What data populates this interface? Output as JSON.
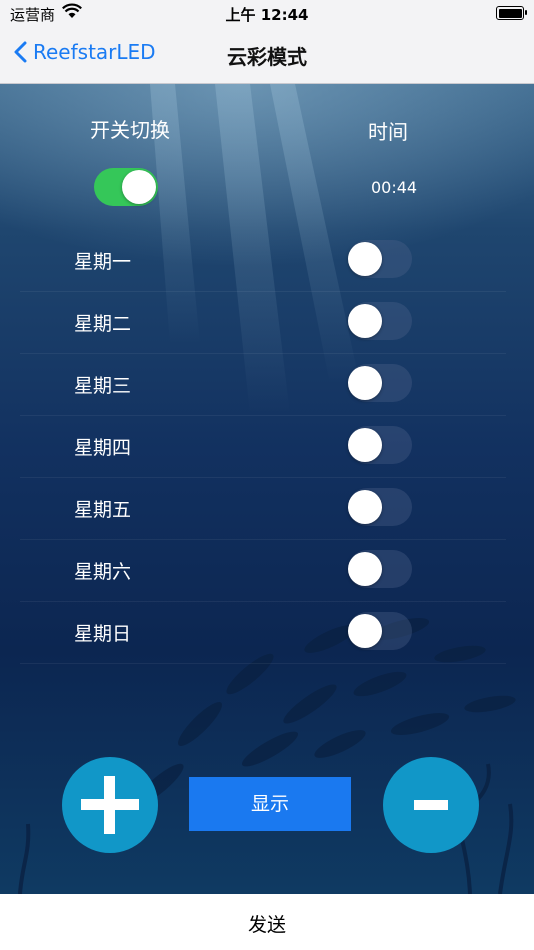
{
  "status_bar": {
    "carrier": "运营商",
    "time": "上午 12:44",
    "battery_level": 1.0
  },
  "nav": {
    "back_label": "ReefstarLED",
    "title": "云彩模式"
  },
  "controls": {
    "switch_header": "开关切换",
    "time_header": "时间",
    "time_value": "00:44",
    "master_on": true
  },
  "days": [
    {
      "label": "星期一",
      "on": false
    },
    {
      "label": "星期二",
      "on": false
    },
    {
      "label": "星期三",
      "on": false
    },
    {
      "label": "星期四",
      "on": false
    },
    {
      "label": "星期五",
      "on": false
    },
    {
      "label": "星期六",
      "on": false
    },
    {
      "label": "星期日",
      "on": false
    }
  ],
  "buttons": {
    "show": "显示",
    "send": "发送"
  },
  "colors": {
    "accent": "#1a79f0",
    "toggle_on": "#35c759",
    "round_button": "#1197c8"
  }
}
